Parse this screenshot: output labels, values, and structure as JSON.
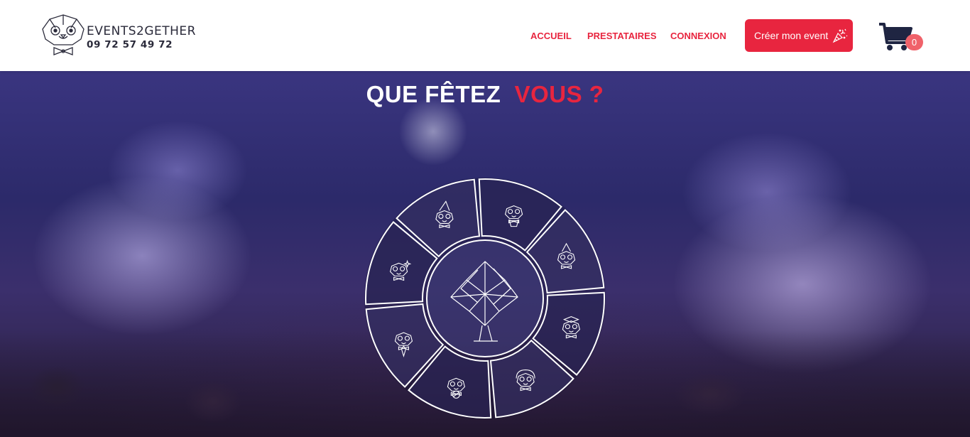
{
  "header": {
    "brand": "EVENTS2GETHER",
    "phone": "09 72 57 49 72",
    "nav": [
      {
        "label": "ACCUEIL"
      },
      {
        "label": "PRESTATAIRES"
      },
      {
        "label": "CONNEXION"
      }
    ],
    "cta_label": "Créer mon event",
    "cart_count": "0"
  },
  "hero": {
    "title_main": "QUE FÊTEZ ",
    "title_accent": "VOUS ?",
    "wheel": {
      "segments": [
        {
          "icon": "trophy-mascot-icon"
        },
        {
          "icon": "party-hat-mascot-icon"
        },
        {
          "icon": "graduation-mascot-icon"
        },
        {
          "icon": "headphones-mascot-icon"
        },
        {
          "icon": "no-symbol-mascot-icon"
        },
        {
          "icon": "tie-mascot-icon"
        },
        {
          "icon": "sparkle-mascot-icon"
        },
        {
          "icon": "wizard-hat-mascot-icon"
        }
      ],
      "center_icon": "origami-diamond-icon"
    }
  },
  "colors": {
    "accent": "#e8253f",
    "badge": "#f0626a",
    "text_dark": "#2a2a3a"
  }
}
